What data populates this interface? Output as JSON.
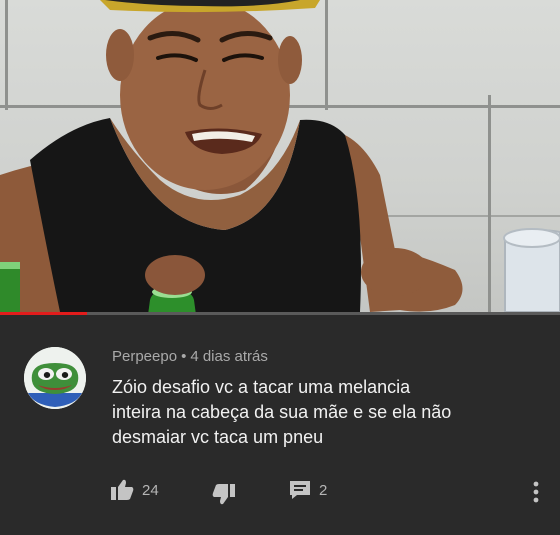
{
  "video": {
    "progress_fraction": 0.155
  },
  "comment": {
    "author": "Perpeepo",
    "separator": "•",
    "time": "4 dias atrás",
    "lines": [
      "Zóio desafio vc a tacar uma melancia",
      "inteira na cabeça da sua mãe e se ela não",
      "desmaiar vc taca um pneu"
    ],
    "likes": "24",
    "replies": "2",
    "avatar_icon": "pepe-frog-avatar"
  },
  "icons": {
    "like": "thumbs-up-icon",
    "dislike": "thumbs-down-icon",
    "reply": "reply-comment-icon",
    "more": "more-vertical-icon"
  },
  "colors": {
    "background": "#2a2a2a",
    "progress": "#e21c1c",
    "meta_text": "#a9a9a9",
    "comment_text": "#f1f1f1"
  }
}
